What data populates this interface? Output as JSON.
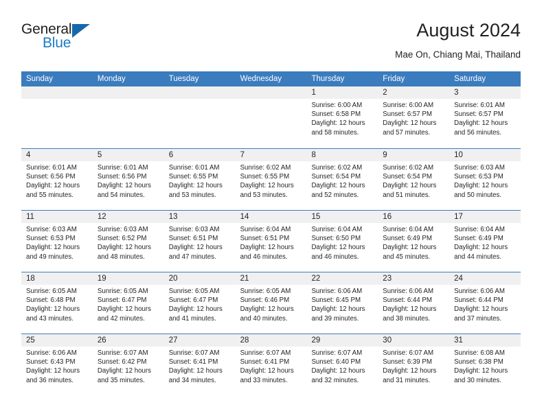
{
  "brand": {
    "name_top": "General",
    "name_bottom": "Blue",
    "accent_color": "#1b7ac4",
    "triangle_color": "#1668ad"
  },
  "header": {
    "title": "August 2024",
    "subtitle": "Mae On, Chiang Mai, Thailand"
  },
  "calendar": {
    "header_bg": "#3a7cbe",
    "daynum_bg": "#f0f0f0",
    "weekdays": [
      "Sunday",
      "Monday",
      "Tuesday",
      "Wednesday",
      "Thursday",
      "Friday",
      "Saturday"
    ],
    "weeks": [
      [
        {
          "day": "",
          "lines": []
        },
        {
          "day": "",
          "lines": []
        },
        {
          "day": "",
          "lines": []
        },
        {
          "day": "",
          "lines": []
        },
        {
          "day": "1",
          "lines": [
            "Sunrise: 6:00 AM",
            "Sunset: 6:58 PM",
            "Daylight: 12 hours",
            "and 58 minutes."
          ]
        },
        {
          "day": "2",
          "lines": [
            "Sunrise: 6:00 AM",
            "Sunset: 6:57 PM",
            "Daylight: 12 hours",
            "and 57 minutes."
          ]
        },
        {
          "day": "3",
          "lines": [
            "Sunrise: 6:01 AM",
            "Sunset: 6:57 PM",
            "Daylight: 12 hours",
            "and 56 minutes."
          ]
        }
      ],
      [
        {
          "day": "4",
          "lines": [
            "Sunrise: 6:01 AM",
            "Sunset: 6:56 PM",
            "Daylight: 12 hours",
            "and 55 minutes."
          ]
        },
        {
          "day": "5",
          "lines": [
            "Sunrise: 6:01 AM",
            "Sunset: 6:56 PM",
            "Daylight: 12 hours",
            "and 54 minutes."
          ]
        },
        {
          "day": "6",
          "lines": [
            "Sunrise: 6:01 AM",
            "Sunset: 6:55 PM",
            "Daylight: 12 hours",
            "and 53 minutes."
          ]
        },
        {
          "day": "7",
          "lines": [
            "Sunrise: 6:02 AM",
            "Sunset: 6:55 PM",
            "Daylight: 12 hours",
            "and 53 minutes."
          ]
        },
        {
          "day": "8",
          "lines": [
            "Sunrise: 6:02 AM",
            "Sunset: 6:54 PM",
            "Daylight: 12 hours",
            "and 52 minutes."
          ]
        },
        {
          "day": "9",
          "lines": [
            "Sunrise: 6:02 AM",
            "Sunset: 6:54 PM",
            "Daylight: 12 hours",
            "and 51 minutes."
          ]
        },
        {
          "day": "10",
          "lines": [
            "Sunrise: 6:03 AM",
            "Sunset: 6:53 PM",
            "Daylight: 12 hours",
            "and 50 minutes."
          ]
        }
      ],
      [
        {
          "day": "11",
          "lines": [
            "Sunrise: 6:03 AM",
            "Sunset: 6:53 PM",
            "Daylight: 12 hours",
            "and 49 minutes."
          ]
        },
        {
          "day": "12",
          "lines": [
            "Sunrise: 6:03 AM",
            "Sunset: 6:52 PM",
            "Daylight: 12 hours",
            "and 48 minutes."
          ]
        },
        {
          "day": "13",
          "lines": [
            "Sunrise: 6:03 AM",
            "Sunset: 6:51 PM",
            "Daylight: 12 hours",
            "and 47 minutes."
          ]
        },
        {
          "day": "14",
          "lines": [
            "Sunrise: 6:04 AM",
            "Sunset: 6:51 PM",
            "Daylight: 12 hours",
            "and 46 minutes."
          ]
        },
        {
          "day": "15",
          "lines": [
            "Sunrise: 6:04 AM",
            "Sunset: 6:50 PM",
            "Daylight: 12 hours",
            "and 46 minutes."
          ]
        },
        {
          "day": "16",
          "lines": [
            "Sunrise: 6:04 AM",
            "Sunset: 6:49 PM",
            "Daylight: 12 hours",
            "and 45 minutes."
          ]
        },
        {
          "day": "17",
          "lines": [
            "Sunrise: 6:04 AM",
            "Sunset: 6:49 PM",
            "Daylight: 12 hours",
            "and 44 minutes."
          ]
        }
      ],
      [
        {
          "day": "18",
          "lines": [
            "Sunrise: 6:05 AM",
            "Sunset: 6:48 PM",
            "Daylight: 12 hours",
            "and 43 minutes."
          ]
        },
        {
          "day": "19",
          "lines": [
            "Sunrise: 6:05 AM",
            "Sunset: 6:47 PM",
            "Daylight: 12 hours",
            "and 42 minutes."
          ]
        },
        {
          "day": "20",
          "lines": [
            "Sunrise: 6:05 AM",
            "Sunset: 6:47 PM",
            "Daylight: 12 hours",
            "and 41 minutes."
          ]
        },
        {
          "day": "21",
          "lines": [
            "Sunrise: 6:05 AM",
            "Sunset: 6:46 PM",
            "Daylight: 12 hours",
            "and 40 minutes."
          ]
        },
        {
          "day": "22",
          "lines": [
            "Sunrise: 6:06 AM",
            "Sunset: 6:45 PM",
            "Daylight: 12 hours",
            "and 39 minutes."
          ]
        },
        {
          "day": "23",
          "lines": [
            "Sunrise: 6:06 AM",
            "Sunset: 6:44 PM",
            "Daylight: 12 hours",
            "and 38 minutes."
          ]
        },
        {
          "day": "24",
          "lines": [
            "Sunrise: 6:06 AM",
            "Sunset: 6:44 PM",
            "Daylight: 12 hours",
            "and 37 minutes."
          ]
        }
      ],
      [
        {
          "day": "25",
          "lines": [
            "Sunrise: 6:06 AM",
            "Sunset: 6:43 PM",
            "Daylight: 12 hours",
            "and 36 minutes."
          ]
        },
        {
          "day": "26",
          "lines": [
            "Sunrise: 6:07 AM",
            "Sunset: 6:42 PM",
            "Daylight: 12 hours",
            "and 35 minutes."
          ]
        },
        {
          "day": "27",
          "lines": [
            "Sunrise: 6:07 AM",
            "Sunset: 6:41 PM",
            "Daylight: 12 hours",
            "and 34 minutes."
          ]
        },
        {
          "day": "28",
          "lines": [
            "Sunrise: 6:07 AM",
            "Sunset: 6:41 PM",
            "Daylight: 12 hours",
            "and 33 minutes."
          ]
        },
        {
          "day": "29",
          "lines": [
            "Sunrise: 6:07 AM",
            "Sunset: 6:40 PM",
            "Daylight: 12 hours",
            "and 32 minutes."
          ]
        },
        {
          "day": "30",
          "lines": [
            "Sunrise: 6:07 AM",
            "Sunset: 6:39 PM",
            "Daylight: 12 hours",
            "and 31 minutes."
          ]
        },
        {
          "day": "31",
          "lines": [
            "Sunrise: 6:08 AM",
            "Sunset: 6:38 PM",
            "Daylight: 12 hours",
            "and 30 minutes."
          ]
        }
      ]
    ]
  }
}
